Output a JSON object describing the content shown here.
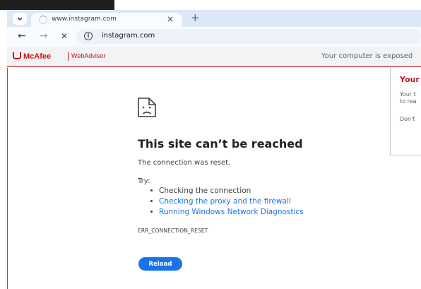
{
  "tab": {
    "title": "www.instagram.com",
    "close_glyph": "×",
    "new_tab_glyph": "+"
  },
  "nav": {
    "back_glyph": "←",
    "forward_glyph": "→",
    "stop_glyph": "✕",
    "url": "instagram.com",
    "info_glyph": "i"
  },
  "mcafee": {
    "brand": "McAfee",
    "product": "WebAdvisor",
    "warning": "Your computer is exposed",
    "brand_color": "#c01818"
  },
  "panel": {
    "title": "Your",
    "body_line1": "Your t",
    "body_line2": "to rea",
    "dont": "Don't"
  },
  "error": {
    "title": "This site can’t be reached",
    "subtitle": "The connection was reset.",
    "try_label": "Try:",
    "suggestions": [
      {
        "text": "Checking the connection",
        "link": false
      },
      {
        "text": "Checking the proxy and the firewall",
        "link": true
      },
      {
        "text": "Running Windows Network Diagnostics",
        "link": true
      }
    ],
    "code": "ERR_CONNECTION_RESET",
    "reload_label": "Reload"
  },
  "colors": {
    "tabstrip": "#dde8f6",
    "accent": "#1a73e8",
    "text": "#202124"
  }
}
